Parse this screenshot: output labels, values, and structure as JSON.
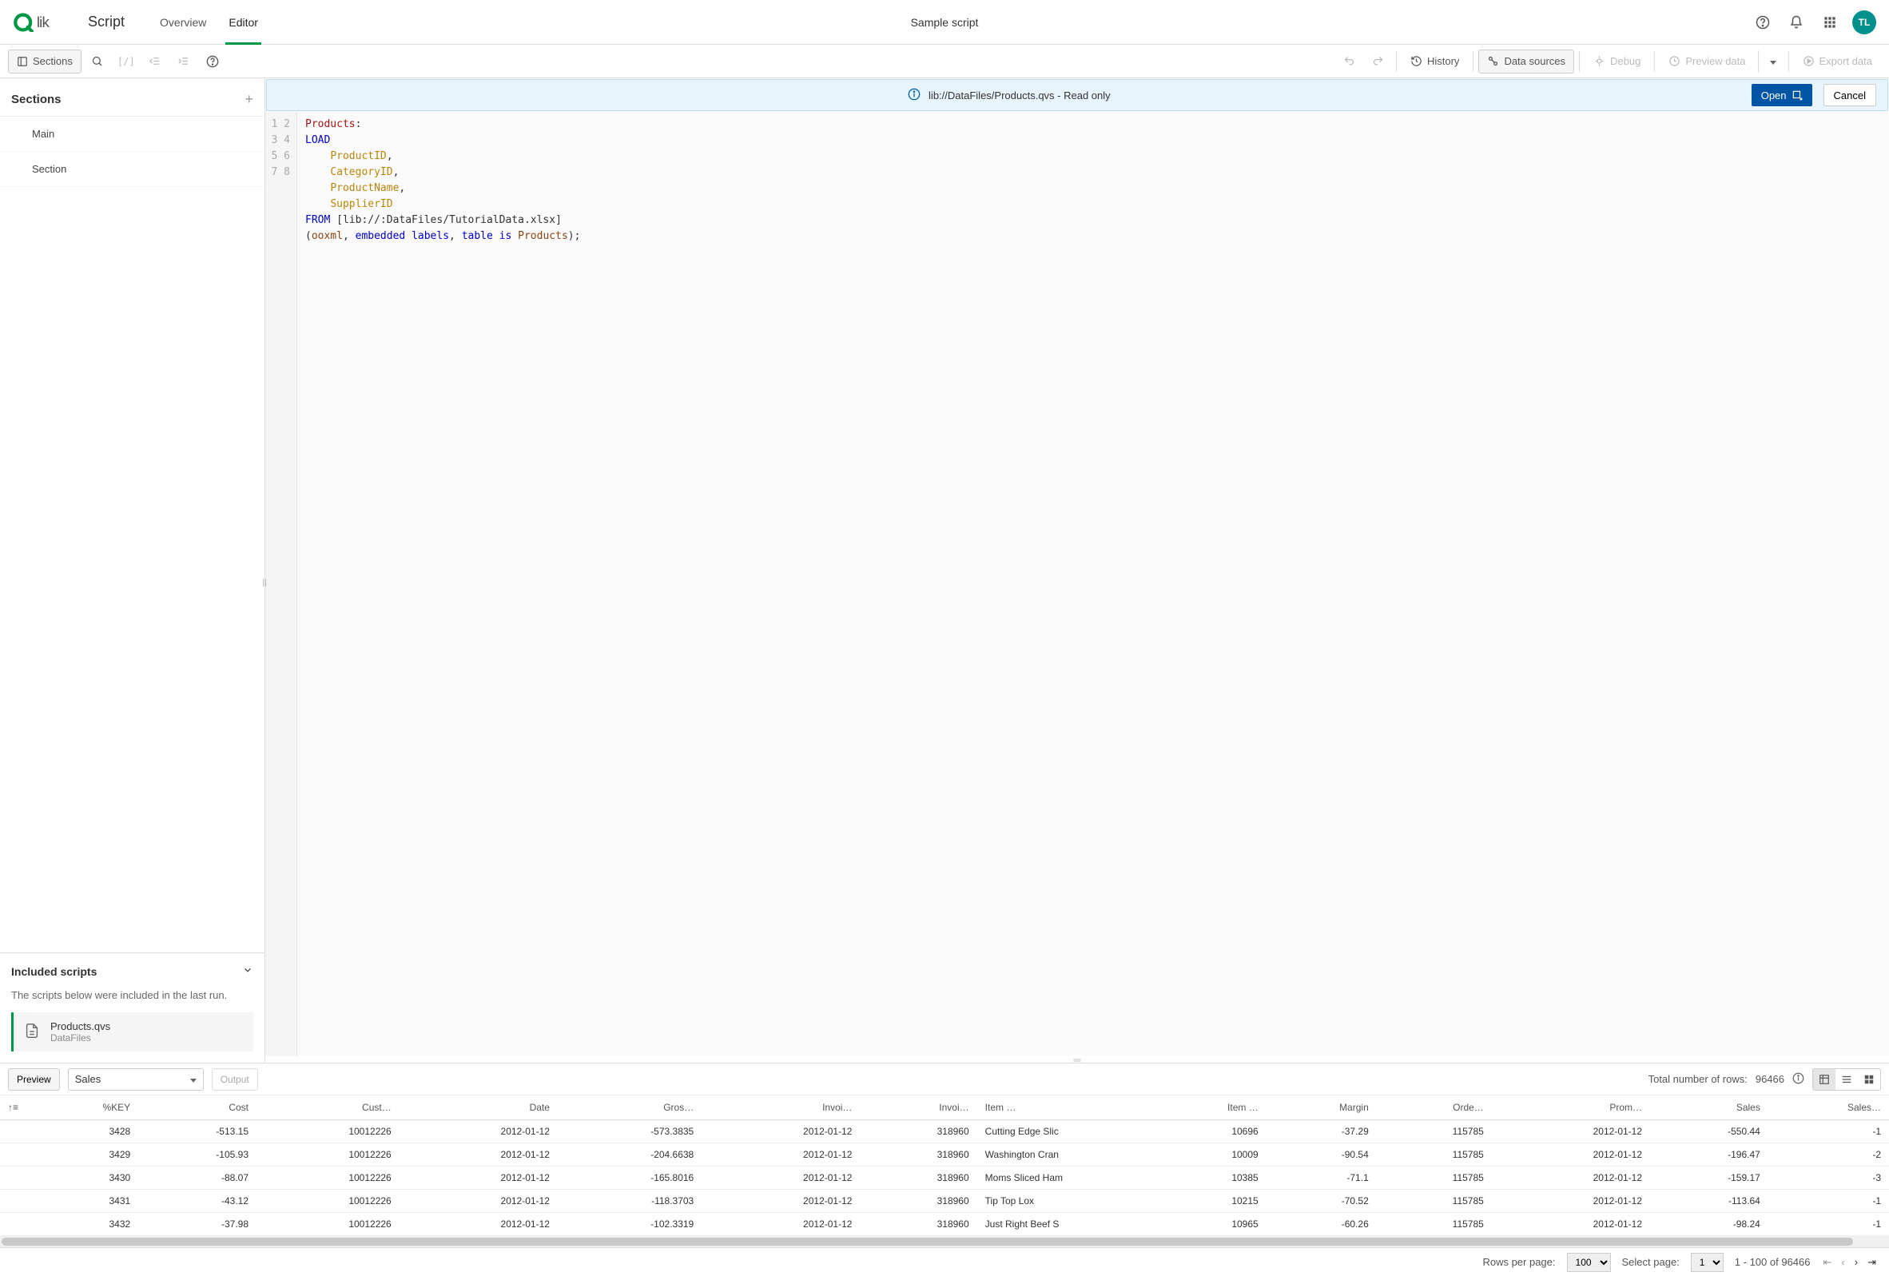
{
  "header": {
    "product": "Qlik",
    "area": "Script",
    "nav": [
      "Overview",
      "Editor"
    ],
    "activeNav": 1,
    "title": "Sample script",
    "avatar": "TL"
  },
  "toolbar": {
    "sections_btn": "Sections",
    "history": "History",
    "data_sources": "Data sources",
    "debug": "Debug",
    "preview_data": "Preview data",
    "export_data": "Export data"
  },
  "sidebar": {
    "title": "Sections",
    "items": [
      "Main",
      "Section"
    ],
    "included": {
      "title": "Included scripts",
      "hint": "The scripts below were included in the last run.",
      "item_name": "Products.qvs",
      "item_source": "DataFiles"
    }
  },
  "notice": {
    "path": "lib://DataFiles/Products.qvs - Read only",
    "open": "Open",
    "cancel": "Cancel"
  },
  "code": {
    "lines": [
      {
        "n": 1,
        "html": "<span class='tok-label'>Products</span>:"
      },
      {
        "n": 2,
        "html": "<span class='tok-kw'>LOAD</span>"
      },
      {
        "n": 3,
        "html": "    <span class='tok-field'>ProductID</span>,"
      },
      {
        "n": 4,
        "html": "    <span class='tok-field'>CategoryID</span>,"
      },
      {
        "n": 5,
        "html": "    <span class='tok-field'>ProductName</span>,"
      },
      {
        "n": 6,
        "html": "    <span class='tok-field'>SupplierID</span>"
      },
      {
        "n": 7,
        "html": "<span class='tok-kw'>FROM</span> [lib://:DataFiles/TutorialData.xlsx]"
      },
      {
        "n": 8,
        "html": "(<span class='tok-ident'>ooxml</span>, <span class='tok-kw'>embedded</span> <span class='tok-kw'>labels</span>, <span class='tok-kw'>table</span> <span class='tok-kw'>is</span> <span class='tok-ident'>Products</span>);"
      }
    ]
  },
  "preview": {
    "tab": "Preview",
    "selector": "Sales",
    "output": "Output",
    "total_rows_label": "Total number of rows:",
    "total_rows": "96466",
    "columns": [
      "%KEY",
      "Cost",
      "Cust…",
      "Date",
      "Gros…",
      "Invoi…",
      "Invoi…",
      "Item …",
      "Item …",
      "Margin",
      "Orde…",
      "Prom…",
      "Sales",
      "Sales…"
    ],
    "col_align": [
      "r",
      "r",
      "r",
      "r",
      "r",
      "r",
      "r",
      "l",
      "r",
      "r",
      "r",
      "r",
      "r",
      "r"
    ],
    "rows": [
      [
        "3428",
        "-513.15",
        "10012226",
        "2012-01-12",
        "-573.3835",
        "2012-01-12",
        "318960",
        "Cutting Edge Slic",
        "10696",
        "-37.29",
        "115785",
        "2012-01-12",
        "-550.44",
        "-1"
      ],
      [
        "3429",
        "-105.93",
        "10012226",
        "2012-01-12",
        "-204.6638",
        "2012-01-12",
        "318960",
        "Washington Cran",
        "10009",
        "-90.54",
        "115785",
        "2012-01-12",
        "-196.47",
        "-2"
      ],
      [
        "3430",
        "-88.07",
        "10012226",
        "2012-01-12",
        "-165.8016",
        "2012-01-12",
        "318960",
        "Moms Sliced Ham",
        "10385",
        "-71.1",
        "115785",
        "2012-01-12",
        "-159.17",
        "-3"
      ],
      [
        "3431",
        "-43.12",
        "10012226",
        "2012-01-12",
        "-118.3703",
        "2012-01-12",
        "318960",
        "Tip Top Lox",
        "10215",
        "-70.52",
        "115785",
        "2012-01-12",
        "-113.64",
        "-1"
      ],
      [
        "3432",
        "-37.98",
        "10012226",
        "2012-01-12",
        "-102.3319",
        "2012-01-12",
        "318960",
        "Just Right Beef S",
        "10965",
        "-60.26",
        "115785",
        "2012-01-12",
        "-98.24",
        "-1"
      ]
    ]
  },
  "footer": {
    "rows_per_page_label": "Rows per page:",
    "rows_per_page": "100",
    "select_page_label": "Select page:",
    "select_page": "1",
    "range": "1 - 100 of 96466"
  }
}
